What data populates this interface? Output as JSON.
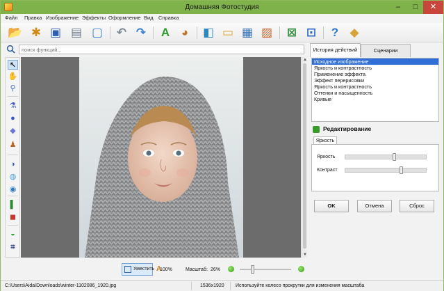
{
  "window": {
    "title": "Домашняя Фотостудия",
    "controls": {
      "minimize": "–",
      "maximize": "□",
      "close": "✕"
    }
  },
  "menu": [
    {
      "label": "Файл"
    },
    {
      "label": "Правка"
    },
    {
      "label": "Изображение"
    },
    {
      "label": "Эффекты"
    },
    {
      "label": "Оформление"
    },
    {
      "label": "Вид"
    },
    {
      "label": "Справка"
    }
  ],
  "toolbar": [
    {
      "icon": "open-folder-icon",
      "glyph": "📂",
      "color": "#e3a21a"
    },
    {
      "icon": "film-reel-icon",
      "glyph": "✱",
      "color": "#d08a14"
    },
    {
      "icon": "save-disk-icon",
      "glyph": "▣",
      "color": "#2d5fb0"
    },
    {
      "icon": "printer-icon",
      "glyph": "▤",
      "color": "#6b7a8a"
    },
    {
      "icon": "print-preview-icon",
      "glyph": "▢",
      "color": "#3b7fd0"
    },
    {
      "icon": "undo-icon",
      "glyph": "↶",
      "color": "#7c8893"
    },
    {
      "icon": "redo-icon",
      "glyph": "↷",
      "color": "#3b82d6"
    },
    {
      "icon": "text-tool-icon",
      "glyph": "A",
      "color": "#2e9b2a"
    },
    {
      "icon": "palette-icon",
      "glyph": "◕",
      "color": "#c2732b"
    },
    {
      "icon": "layers-icon",
      "glyph": "◧",
      "color": "#2e86c1"
    },
    {
      "icon": "frame-icon",
      "glyph": "▭",
      "color": "#d9a428"
    },
    {
      "icon": "calendar-icon",
      "glyph": "▦",
      "color": "#2e6fb8"
    },
    {
      "icon": "picture-icon",
      "glyph": "▨",
      "color": "#cf5e28"
    },
    {
      "icon": "fit-screen-icon",
      "glyph": "⊠",
      "color": "#2f8a3a"
    },
    {
      "icon": "actual-size-icon",
      "glyph": "⊡",
      "color": "#2d6bc0"
    },
    {
      "icon": "help-icon",
      "glyph": "?",
      "color": "#2f77c9"
    },
    {
      "icon": "package-icon",
      "glyph": "◆",
      "color": "#d8a33a"
    }
  ],
  "search": {
    "placeholder": "поиск функций..."
  },
  "tools": [
    {
      "icon": "pointer-icon",
      "glyph": "↖",
      "color": "#1c1c1c",
      "active": true
    },
    {
      "icon": "hand-icon",
      "glyph": "✋",
      "color": "#555555"
    },
    {
      "icon": "magnifier-icon",
      "glyph": "⚲",
      "color": "#3a6fb5"
    },
    {
      "icon": "pipette-icon",
      "glyph": "⚗",
      "color": "#3a57c8"
    },
    {
      "icon": "drop-icon",
      "glyph": "●",
      "color": "#3a57c8"
    },
    {
      "icon": "blur-drop-icon",
      "glyph": "◆",
      "color": "#6a7ad0"
    },
    {
      "icon": "stamp-icon",
      "glyph": "♟",
      "color": "#b8661f"
    },
    {
      "icon": "half-circle-icon",
      "glyph": "◑",
      "color": "#2e5fa8"
    },
    {
      "icon": "ellipse-icon",
      "glyph": "◍",
      "color": "#4aa3d8"
    },
    {
      "icon": "red-eye-icon",
      "glyph": "◉",
      "color": "#2b78c4"
    },
    {
      "icon": "color-channels-icon",
      "glyph": "▌",
      "color": "#2a8a36"
    },
    {
      "icon": "color-squares-icon",
      "glyph": "◼",
      "color": "#c63a2e"
    },
    {
      "icon": "eraser-icon",
      "glyph": "◒",
      "color": "#3aa335"
    },
    {
      "icon": "crop-icon",
      "glyph": "⌗",
      "color": "#2c3f8a"
    }
  ],
  "zoom": {
    "fit_label": "Уместить",
    "full_label": "100%",
    "scale_label": "Масштаб:",
    "scale_value": "26%",
    "slider_fraction": 0.26
  },
  "status": {
    "path": "C:\\Users\\Aida\\Downloads\\winter-1102086_1920.jpg",
    "dimensions": "1536x1920",
    "hint": "Используйте колесо прокрутки для изменения масштаба"
  },
  "panel": {
    "tabs": [
      {
        "label": "История действий",
        "active": true
      },
      {
        "label": "Сценарии",
        "active": false
      }
    ],
    "history": [
      {
        "label": "Исходное изображение",
        "selected": true
      },
      {
        "label": "Яркость и контрастность"
      },
      {
        "label": "Применение эффекта"
      },
      {
        "label": "Эффект перерисовки"
      },
      {
        "label": "Яркость и контрастность"
      },
      {
        "label": "Оттенки и насыщенность"
      },
      {
        "label": "Кривые"
      }
    ],
    "editing_title": "Редактирование",
    "sub_tab": "Яркость",
    "sliders": [
      {
        "label": "Яркость",
        "value": 0.6
      },
      {
        "label": "Контраст",
        "value": 0.69
      }
    ],
    "buttons": {
      "ok": "OK",
      "cancel": "Отмена",
      "reset": "Сброс"
    }
  }
}
